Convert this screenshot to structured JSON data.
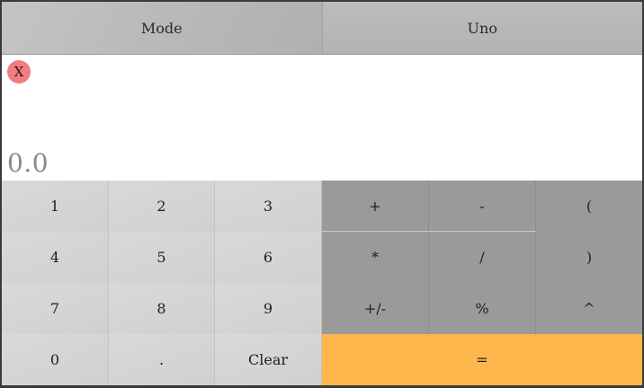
{
  "header": {
    "mode_label": "Mode",
    "uno_label": "Uno"
  },
  "display": {
    "close_label": "X",
    "value": "0.0"
  },
  "keypad": {
    "digits": [
      "1",
      "2",
      "3",
      "4",
      "5",
      "6",
      "7",
      "8",
      "9",
      "0"
    ],
    "dot": ".",
    "clear": "Clear",
    "plus": "+",
    "minus": "-",
    "open_paren": "(",
    "multiply": "*",
    "divide": "/",
    "close_paren": ")",
    "negate": "+/-",
    "percent": "%",
    "power": "^",
    "equals": "="
  },
  "colors": {
    "accent": "#fdb64c",
    "close": "#f07d83"
  }
}
